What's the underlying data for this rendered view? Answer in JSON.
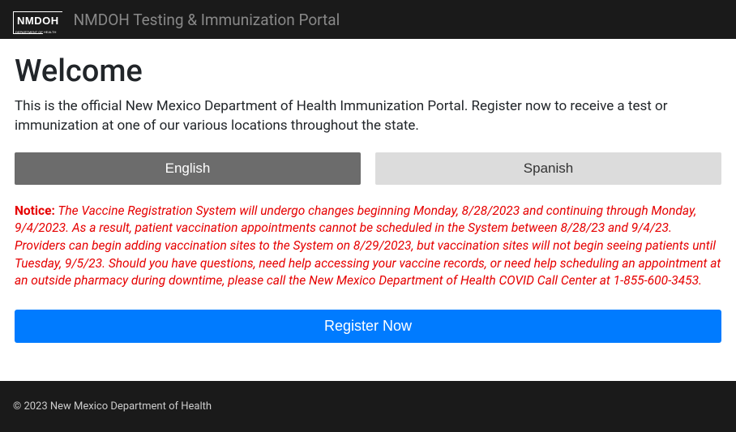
{
  "navbar": {
    "logo_text": "NMDOH",
    "title": "NMDOH Testing & Immunization Portal"
  },
  "main": {
    "heading": "Welcome",
    "intro": "This is the official New Mexico Department of Health Immunization Portal. Register now to receive a test or immunization at one of our various locations throughout the state.",
    "lang_english": "English",
    "lang_spanish": "Spanish",
    "notice_label": "Notice:",
    "notice_body": " The Vaccine Registration System will undergo changes beginning Monday, 8/28/2023 and continuing through Monday, 9/4/2023. As a result, patient vaccination appointments cannot be scheduled in the System between 8/28/23 and 9/4/23. Providers can begin adding vaccination sites to the System on 8/29/2023, but vaccination sites will not begin seeing patients until Tuesday, 9/5/23. Should you have questions, need help accessing your vaccine records, or need help scheduling an appointment at an outside pharmacy during downtime, please call the New Mexico Department of Health COVID Call Center at 1-855-600-3453.",
    "register_label": "Register Now"
  },
  "footer": {
    "copyright": "© 2023 New Mexico Department of Health"
  }
}
